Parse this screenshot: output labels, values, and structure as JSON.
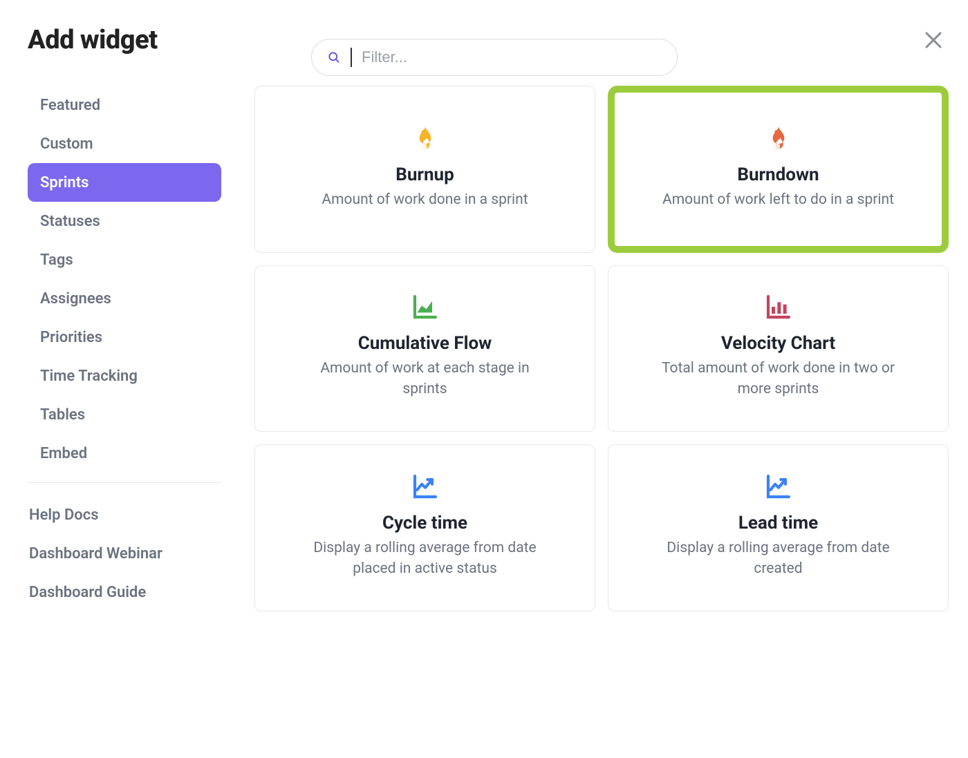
{
  "header": {
    "title": "Add widget"
  },
  "search": {
    "placeholder": "Filter..."
  },
  "sidebar": {
    "items": [
      {
        "label": "Featured",
        "active": false
      },
      {
        "label": "Custom",
        "active": false
      },
      {
        "label": "Sprints",
        "active": true
      },
      {
        "label": "Statuses",
        "active": false
      },
      {
        "label": "Tags",
        "active": false
      },
      {
        "label": "Assignees",
        "active": false
      },
      {
        "label": "Priorities",
        "active": false
      },
      {
        "label": "Time Tracking",
        "active": false
      },
      {
        "label": "Tables",
        "active": false
      },
      {
        "label": "Embed",
        "active": false
      }
    ],
    "links": [
      {
        "label": "Help Docs"
      },
      {
        "label": "Dashboard Webinar"
      },
      {
        "label": "Dashboard Guide"
      }
    ]
  },
  "widgets": [
    {
      "icon": "flame-yellow",
      "title": "Burnup",
      "desc": "Amount of work done in a sprint",
      "selected": false
    },
    {
      "icon": "flame-orange",
      "title": "Burndown",
      "desc": "Amount of work left to do in a sprint",
      "selected": true
    },
    {
      "icon": "area-green",
      "title": "Cumulative Flow",
      "desc": "Amount of work at each stage in sprints",
      "selected": false
    },
    {
      "icon": "bar-red",
      "title": "Velocity Chart",
      "desc": "Total amount of work done in two or more sprints",
      "selected": false
    },
    {
      "icon": "line-blue",
      "title": "Cycle time",
      "desc": "Display a rolling average from date placed in active status",
      "selected": false
    },
    {
      "icon": "line-blue",
      "title": "Lead time",
      "desc": "Display a rolling average from date created",
      "selected": false
    }
  ],
  "colors": {
    "accent": "#7b68ee",
    "highlight": "#9ccc3c",
    "flame_yellow": "#f5b429",
    "flame_orange": "#e7673e",
    "area_green": "#4caf50",
    "bar_red": "#c2455c",
    "line_blue": "#3b82f6"
  }
}
